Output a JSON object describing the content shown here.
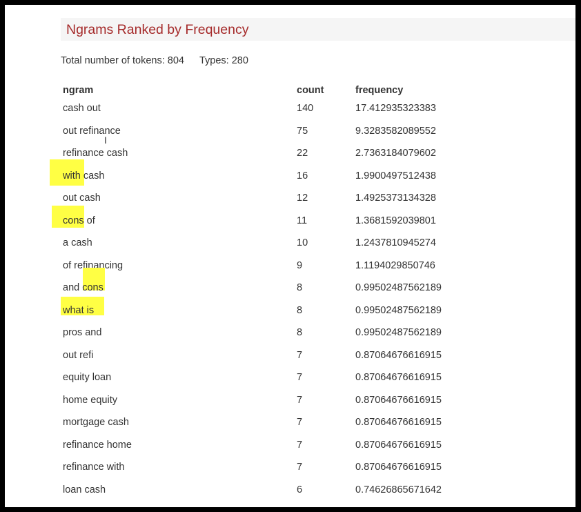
{
  "header": {
    "title": "Ngrams Ranked by Frequency"
  },
  "stats": {
    "tokens": "Total number of tokens: 804",
    "types": "Types: 280"
  },
  "table": {
    "columns": [
      "ngram",
      "count",
      "frequency"
    ],
    "rows": [
      [
        "cash out",
        "140",
        "17.412935323383"
      ],
      [
        "out refinance",
        "75",
        "9.3283582089552"
      ],
      [
        "refinance cash",
        "22",
        "2.7363184079602"
      ],
      [
        "with cash",
        "16",
        "1.9900497512438"
      ],
      [
        "out cash",
        "12",
        "1.4925373134328"
      ],
      [
        "cons of",
        "11",
        "1.3681592039801"
      ],
      [
        "a cash",
        "10",
        "1.2437810945274"
      ],
      [
        "of refinancing",
        "9",
        "1.1194029850746"
      ],
      [
        "and cons",
        "8",
        "0.99502487562189"
      ],
      [
        "what is",
        "8",
        "0.99502487562189"
      ],
      [
        "pros and",
        "8",
        "0.99502487562189"
      ],
      [
        "out refi",
        "7",
        "0.87064676616915"
      ],
      [
        "equity loan",
        "7",
        "0.87064676616915"
      ],
      [
        "home equity",
        "7",
        "0.87064676616915"
      ],
      [
        "mortgage cash",
        "7",
        "0.87064676616915"
      ],
      [
        "refinance home",
        "7",
        "0.87064676616915"
      ],
      [
        "refinance with",
        "7",
        "0.87064676616915"
      ],
      [
        "loan cash",
        "6",
        "0.74626865671642"
      ]
    ]
  },
  "highlight_color": "#ffff44",
  "title_color": "#a52a2a"
}
